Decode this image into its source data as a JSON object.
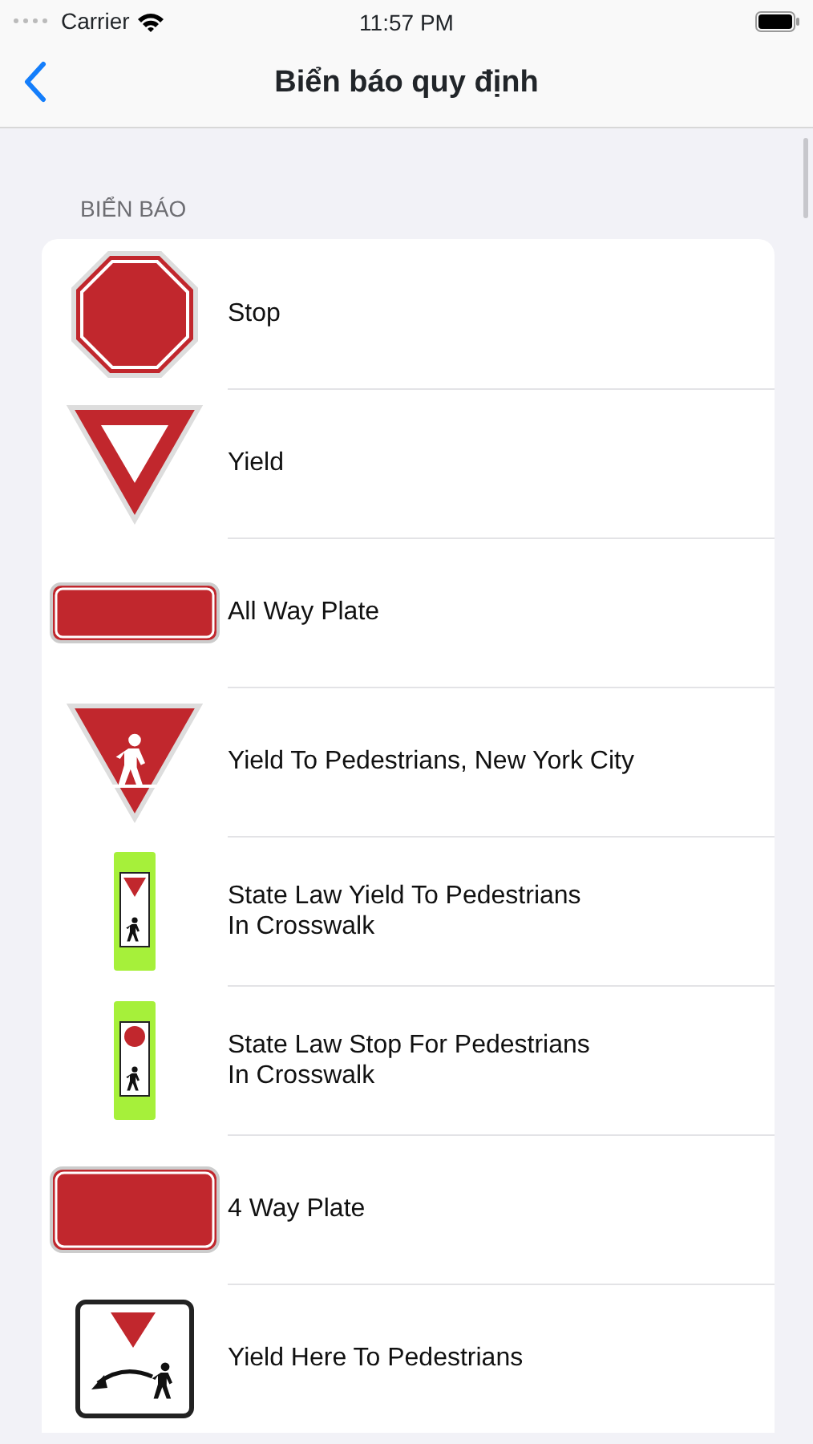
{
  "status_bar": {
    "carrier": "Carrier",
    "time": "11:57 PM"
  },
  "nav": {
    "title": "Biển báo quy định"
  },
  "section": {
    "header": "BIỂN BÁO",
    "rows": [
      {
        "kind": "stop",
        "label": "Stop"
      },
      {
        "kind": "yield",
        "label": "Yield"
      },
      {
        "kind": "plate",
        "label": "All Way Plate"
      },
      {
        "kind": "yield-ped",
        "label": "Yield To Pedestrians, New York City"
      },
      {
        "kind": "law-yield",
        "label": "State Law Yield To Pedestrians\nIn Crosswalk"
      },
      {
        "kind": "law-stop",
        "label": "State Law Stop For Pedestrians\nIn Crosswalk"
      },
      {
        "kind": "plate-large",
        "label": "4 Way Plate"
      },
      {
        "kind": "yield-here",
        "label": "Yield Here To Pedestrians"
      }
    ]
  }
}
